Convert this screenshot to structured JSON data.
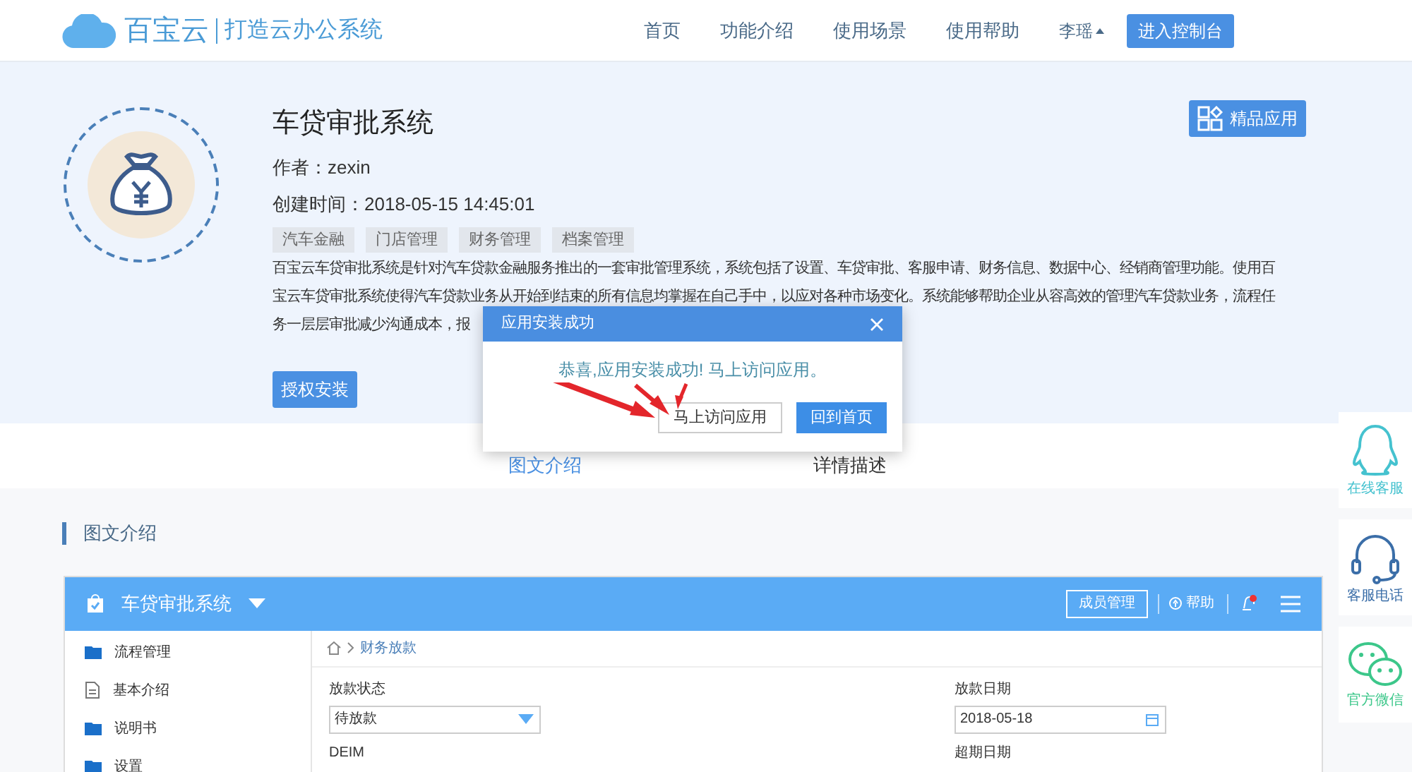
{
  "header": {
    "brand": "百宝云",
    "slogan": "打造云办公系统",
    "nav": [
      {
        "label": "首页"
      },
      {
        "label": "功能介绍"
      },
      {
        "label": "使用场景"
      },
      {
        "label": "使用帮助"
      }
    ],
    "user": "李瑶",
    "console_button": "进入控制台"
  },
  "app": {
    "title": "车贷审批系统",
    "author": "作者：zexin",
    "created": "创建时间：2018-05-15 14:45:01",
    "tags": [
      "汽车金融",
      "门店管理",
      "财务管理",
      "档案管理"
    ],
    "description_lines": [
      "百宝云车贷审批系统是针对汽车贷款金融服务推出的一套审批管理系统，系统包括了设置、车贷审批、客服申请、财务信息、数据中心、经销商管理功能。使用百",
      "宝云车贷审批系统使得汽车贷款业务从开始到结束的所有信息均掌握在自己手中，以应对各种市场变化。系统能够帮助企业从容高效的管理汽车贷款业务，流程任",
      "务一层层审批减少沟通成本，报"
    ],
    "install_button": "授权安装",
    "badge": "精品应用"
  },
  "tabs": [
    {
      "label": "图文介绍",
      "selected": true
    },
    {
      "label": "详情描述",
      "selected": false
    }
  ],
  "section_title": "图文介绍",
  "preview": {
    "title": "车贷审批系统",
    "member_button": "成员管理",
    "help": "帮助",
    "sidebar": [
      {
        "label": "流程管理",
        "kind": "folder"
      },
      {
        "label": "基本介绍",
        "kind": "file"
      },
      {
        "label": "说明书",
        "kind": "folder"
      },
      {
        "label": "设置",
        "kind": "folder"
      }
    ],
    "breadcrumb": "财务放款",
    "fields": [
      {
        "label": "放款状态",
        "value": "待放款",
        "kind": "select"
      },
      {
        "label": "放款日期",
        "value": "2018-05-18",
        "kind": "date"
      }
    ],
    "more_labels": [
      "DEIM",
      "超期日期"
    ]
  },
  "float_bar": [
    {
      "label": "在线客服",
      "kind": "qq"
    },
    {
      "label": "客服电话",
      "kind": "phone"
    },
    {
      "label": "官方微信",
      "kind": "wechat"
    }
  ],
  "dialog": {
    "title": "应用安装成功",
    "message": "恭喜,应用安装成功! 马上访问应用。",
    "buttons": [
      {
        "label": "马上访问应用",
        "kind": "secondary"
      },
      {
        "label": "回到首页",
        "kind": "primary"
      }
    ]
  }
}
